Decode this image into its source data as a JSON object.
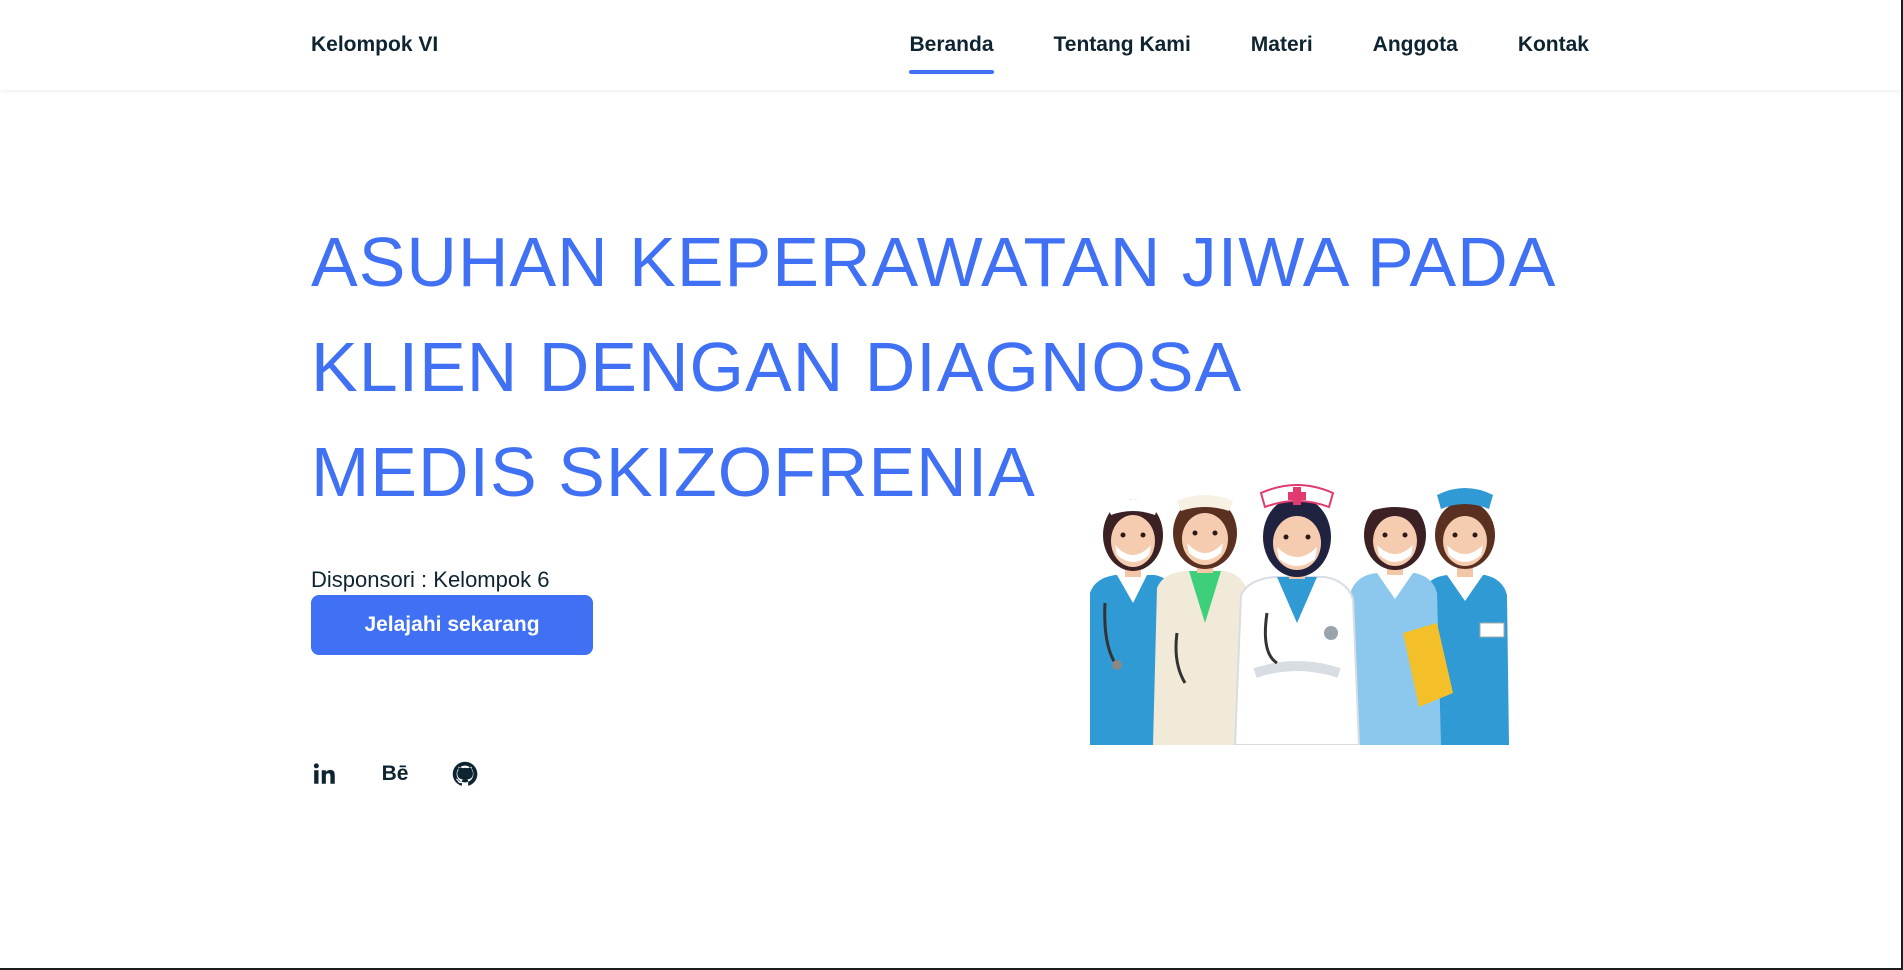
{
  "header": {
    "logo": "Kelompok VI",
    "nav": [
      {
        "label": "Beranda",
        "active": true
      },
      {
        "label": "Tentang Kami",
        "active": false
      },
      {
        "label": "Materi",
        "active": false
      },
      {
        "label": "Anggota",
        "active": false
      },
      {
        "label": "Kontak",
        "active": false
      }
    ]
  },
  "hero": {
    "title_lines": [
      "ASUHAN KEPERAWATAN JIWA PADA",
      "KLIEN DENGAN DIAGNOSA",
      "MEDIS SKIZOFRENIA"
    ],
    "sponsor": "Disponsori : Kelompok 6",
    "cta_label": "Jelajahi sekarang"
  },
  "socials": [
    {
      "icon": "linkedin-icon",
      "glyph": "in"
    },
    {
      "icon": "behance-icon",
      "glyph": "Bē"
    },
    {
      "icon": "github-icon",
      "glyph": ""
    }
  ],
  "colors": {
    "accent": "#4070f4",
    "text": "#0e2431"
  }
}
